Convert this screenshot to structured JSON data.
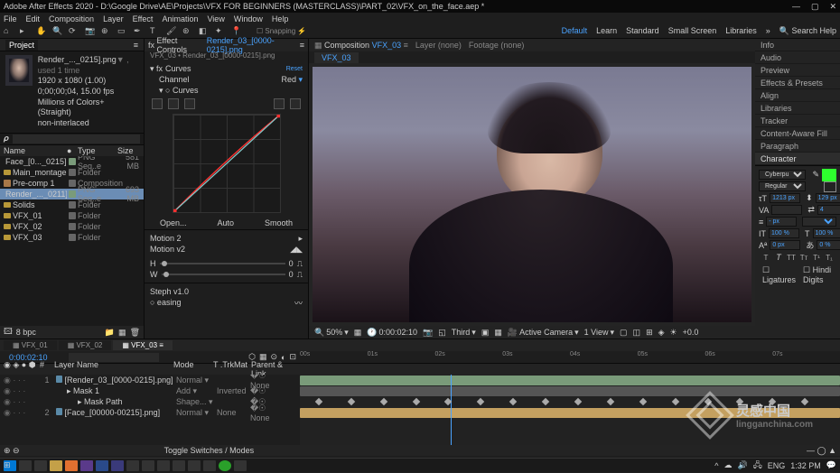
{
  "title": "Adobe After Effects 2020 - D:\\Google Drive\\AE\\Projects\\VFX FOR BEGINNERS (MASTERCLASS)\\PART_02\\VFX_on_the_face.aep *",
  "menu": [
    "File",
    "Edit",
    "Composition",
    "Layer",
    "Effect",
    "Animation",
    "View",
    "Window",
    "Help"
  ],
  "workspaces": {
    "items": [
      "Default",
      "Learn",
      "Standard",
      "Small Screen",
      "Libraries"
    ],
    "search": "Search Help"
  },
  "project": {
    "tab": "Project",
    "selected_name": "Render_..._0215].png",
    "selected_used": "▼ , used 1 time",
    "info": [
      "1920 x 1080 (1.00)",
      "0;00;00;04, 15.00 fps",
      "Millions of Colors+ (Straight)",
      "non-interlaced"
    ],
    "cols": {
      "name": "Name",
      "tag": "●",
      "type": "Type",
      "size": "Size",
      "fr": "Fr"
    },
    "items": [
      {
        "name": "Face_[0..._0215].png",
        "type": "PNG Seq..e",
        "size": "581 MB",
        "ic": "file",
        "tag": "#7a9b7a"
      },
      {
        "name": "Main_montage",
        "type": "Folder",
        "size": "",
        "ic": "folder",
        "tag": "#666"
      },
      {
        "name": "Pre-comp 1",
        "type": "Composition",
        "size": "",
        "ic": "comp",
        "tag": "#666"
      },
      {
        "name": "Render_..._0211].png",
        "type": "PNG Seq..e",
        "size": "693 MB",
        "ic": "file",
        "tag": "#7a9b7a",
        "selected": true
      },
      {
        "name": "Solids",
        "type": "Folder",
        "size": "",
        "ic": "folder",
        "tag": "#666"
      },
      {
        "name": "VFX_01",
        "type": "Folder",
        "size": "",
        "ic": "folder",
        "tag": "#666"
      },
      {
        "name": "VFX_02",
        "type": "Folder",
        "size": "",
        "ic": "folder",
        "tag": "#666"
      },
      {
        "name": "VFX_03",
        "type": "Folder",
        "size": "",
        "ic": "folder",
        "tag": "#666"
      }
    ],
    "bpc": "8 bpc"
  },
  "effects": {
    "tab_label": "Effect Controls",
    "tab_active": "Render_03_[0000-0215].png",
    "breadcrumb": "VFX_03 • Render_03_[0000-0215].png",
    "curves": {
      "name": "Curves",
      "reset": "Reset",
      "channel_lbl": "Channel",
      "channel_val": "Red",
      "sub": "Curves",
      "btns": {
        "open": "Open...",
        "auto": "Auto",
        "smooth": "Smooth"
      }
    },
    "motion2": {
      "name": "Motion 2",
      "v2": "Motion v2",
      "labels": [
        "H",
        "W"
      ],
      "vals": [
        "0",
        "0"
      ]
    },
    "steph": {
      "name": "Steph v1.0",
      "easing": "○ easing"
    }
  },
  "viewer": {
    "tabs": {
      "comp_lbl": "Composition",
      "comp_active": "VFX_03",
      "layer": "Layer (none)",
      "footage": "Footage (none)"
    },
    "comptab": "VFX_03",
    "ctrl": {
      "zoom": "50%",
      "time": "0:00:02:10",
      "res": "Third",
      "cam": "Active Camera",
      "views": "1 View"
    }
  },
  "right": {
    "items": [
      "Info",
      "Audio",
      "Preview",
      "Effects & Presets",
      "Align",
      "Libraries",
      "Tracker",
      "Content-Aware Fill",
      "Paragraph"
    ],
    "char": {
      "title": "Character",
      "font": "Cyberpunkies",
      "style": "Regular",
      "size": "1213 px",
      "leading": "129 px",
      "kerning": "",
      "tracking": "4",
      "vscale": "100 %",
      "hscale": "100 %",
      "baseline": "0 px",
      "tsume": "0 %",
      "ligatures": "Ligatures",
      "hindi": "Hindi Digits"
    }
  },
  "timeline": {
    "tabs": [
      "VFX_01",
      "VFX_02",
      "VFX_03"
    ],
    "active": 2,
    "time": "0:00:02:10",
    "cols": {
      "idx": "#",
      "layer": "Layer Name",
      "mode": "Mode",
      "trk": "T .TrkMat",
      "parent": "Parent & Link"
    },
    "ruler": [
      "00s",
      "01s",
      "02s",
      "03s",
      "04s",
      "05s",
      "06s",
      "07s"
    ],
    "layers": [
      {
        "n": "1",
        "name": "[Render_03_[0000-0215].png]",
        "mode": "Normal",
        "trk": "",
        "parent": "None",
        "ic": "file"
      },
      {
        "n": "",
        "name": "Mask 1",
        "mode": "Add",
        "trk": "Inverted",
        "parent": "",
        "indent": 1
      },
      {
        "n": "",
        "name": "Mask Path",
        "mode": "Shape...",
        "trk": "",
        "parent": "",
        "indent": 2,
        "val": true
      },
      {
        "n": "2",
        "name": "[Face_[00000-00215].png]",
        "mode": "Normal",
        "trk": "None",
        "parent": "None",
        "ic": "file"
      }
    ],
    "footer": "Toggle Switches / Modes"
  },
  "taskbar": {
    "lang": "ENG",
    "time": "1:32 PM",
    "apps": 10
  },
  "watermark": {
    "text": "灵感中国",
    "domain": "lingganchina.com"
  }
}
